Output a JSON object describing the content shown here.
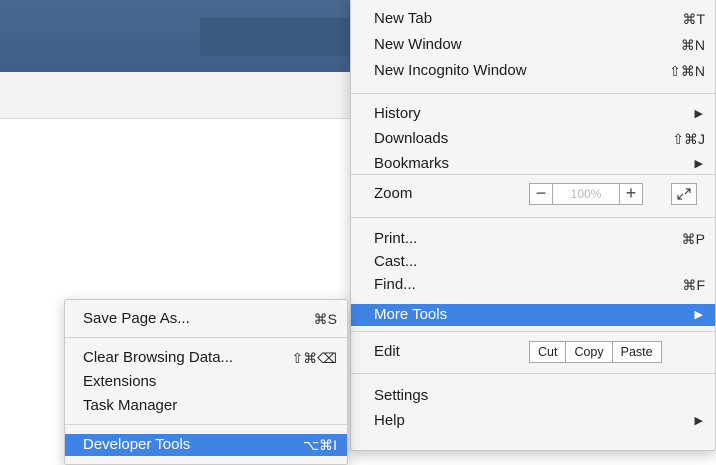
{
  "browser": {
    "toolbar_color": "#3e5f87"
  },
  "main_menu": {
    "new_tab": {
      "label": "New Tab",
      "shortcut": "⌘T"
    },
    "new_window": {
      "label": "New Window",
      "shortcut": "⌘N"
    },
    "new_incognito": {
      "label": "New Incognito Window",
      "shortcut": "⇧⌘N"
    },
    "history": {
      "label": "History",
      "arrow": "▶"
    },
    "downloads": {
      "label": "Downloads",
      "shortcut": "⇧⌘J"
    },
    "bookmarks": {
      "label": "Bookmarks",
      "arrow": "▶"
    },
    "zoom": {
      "label": "Zoom",
      "minus": "−",
      "value": "100%",
      "plus": "+",
      "fullscreen_icon": "fullscreen-icon"
    },
    "print": {
      "label": "Print...",
      "shortcut": "⌘P"
    },
    "cast": {
      "label": "Cast..."
    },
    "find": {
      "label": "Find...",
      "shortcut": "⌘F"
    },
    "more_tools": {
      "label": "More Tools",
      "arrow": "▶",
      "highlighted": true
    },
    "edit": {
      "label": "Edit",
      "cut": "Cut",
      "copy": "Copy",
      "paste": "Paste"
    },
    "settings": {
      "label": "Settings"
    },
    "help": {
      "label": "Help",
      "arrow": "▶"
    }
  },
  "more_tools_menu": {
    "save_page": {
      "label": "Save Page As...",
      "shortcut": "⌘S"
    },
    "clear_data": {
      "label": "Clear Browsing Data...",
      "shortcut": "⇧⌘⌫"
    },
    "extensions": {
      "label": "Extensions"
    },
    "task_manager": {
      "label": "Task Manager"
    },
    "developer_tools": {
      "label": "Developer Tools",
      "shortcut": "⌥⌘I",
      "highlighted": true
    }
  },
  "colors": {
    "highlight": "#3f84e5",
    "menu_bg": "#f5f5f5"
  }
}
